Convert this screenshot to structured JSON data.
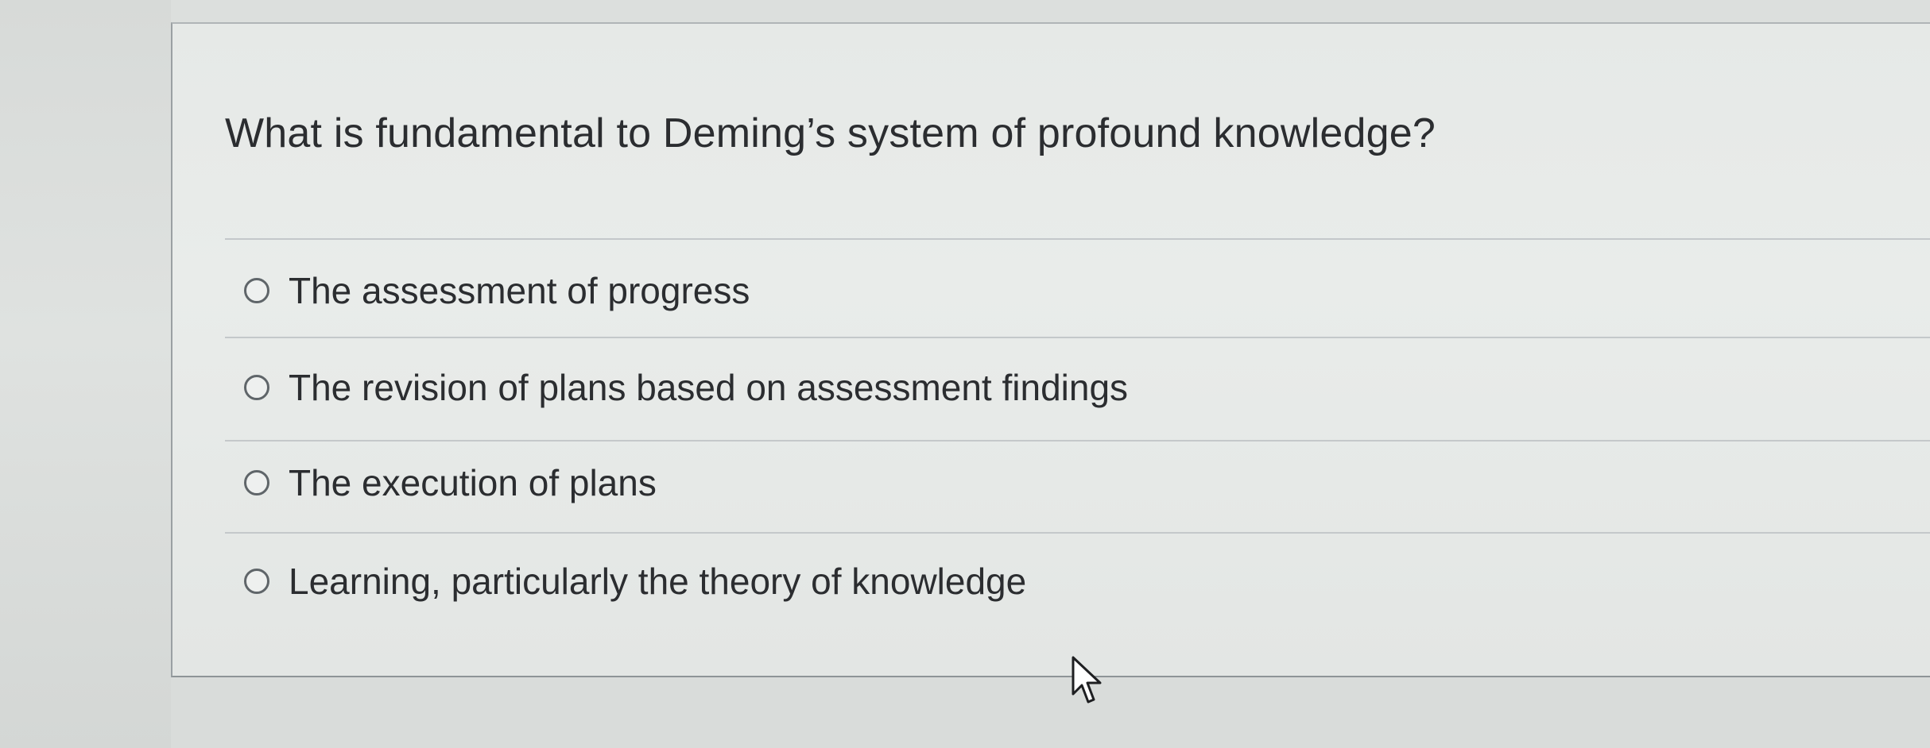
{
  "question": {
    "text": "What is fundamental to Deming’s system of profound knowledge?"
  },
  "options": [
    {
      "label": "The assessment of progress",
      "selected": false
    },
    {
      "label": "The revision of plans based on assessment findings",
      "selected": false
    },
    {
      "label": "The execution of plans",
      "selected": false
    },
    {
      "label": "Learning, particularly the theory of knowledge",
      "selected": false
    }
  ],
  "icons": {
    "cursor": "mouse-pointer-icon",
    "radio": "radio-button-unselected"
  },
  "colors": {
    "text": "#2b2d30",
    "radio_border": "#5f6569",
    "background": "#e6e9e7"
  }
}
